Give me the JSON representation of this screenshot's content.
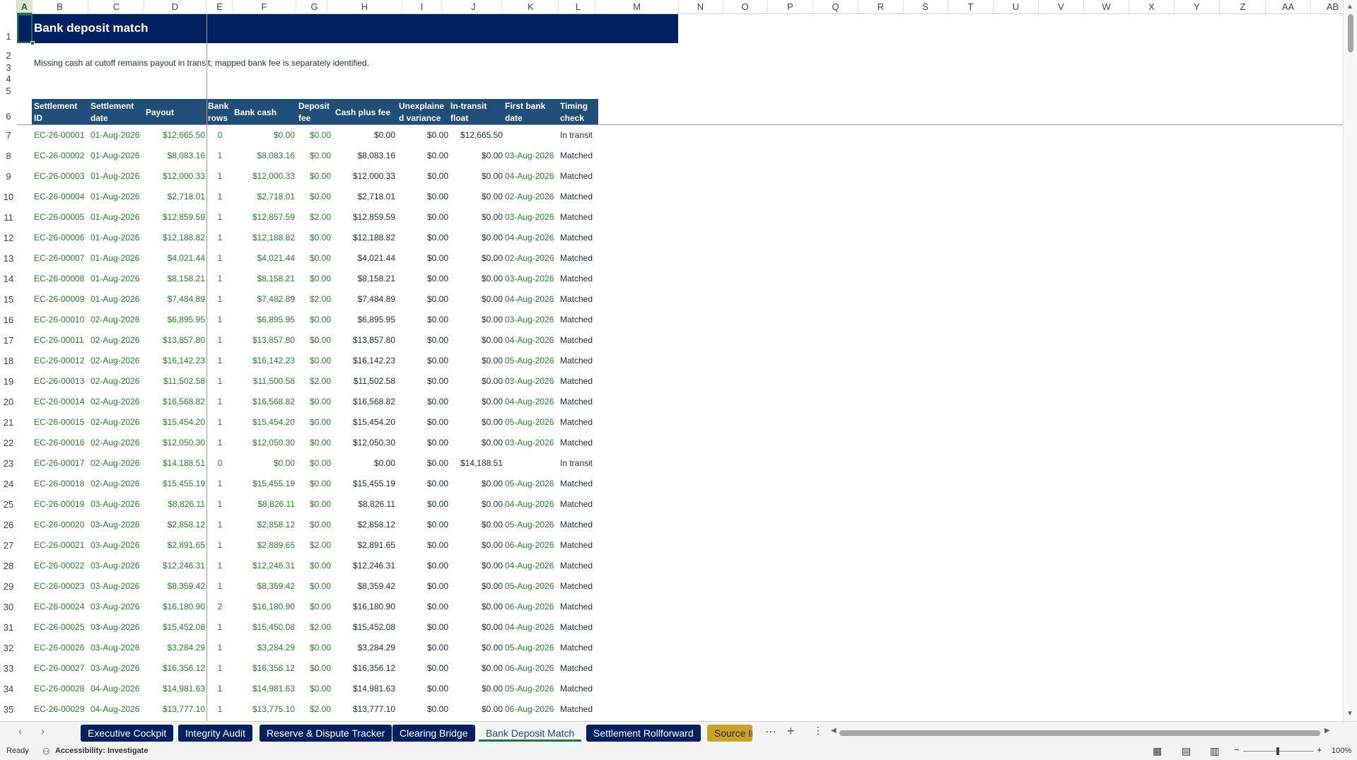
{
  "columns": [
    "A",
    "B",
    "C",
    "D",
    "E",
    "F",
    "G",
    "H",
    "I",
    "J",
    "K",
    "L",
    "M",
    "N",
    "O",
    "P",
    "Q",
    "R",
    "S",
    "T",
    "U",
    "V",
    "W",
    "X",
    "Y",
    "Z",
    "AA",
    "AB"
  ],
  "row_numbers": [
    "1",
    "2",
    "3",
    "4",
    "5",
    "6",
    "7",
    "8",
    "9",
    "10",
    "11",
    "12",
    "13",
    "14",
    "15",
    "16",
    "17",
    "18",
    "19",
    "20",
    "21",
    "22",
    "23",
    "24",
    "25",
    "26",
    "27",
    "28",
    "29",
    "30",
    "31",
    "32",
    "33",
    "34",
    "35"
  ],
  "sheet": {
    "title": "Bank deposit match",
    "subtitle": "Missing cash at cutoff remains payout in transit; mapped bank fee is separately identified.",
    "headers": [
      {
        "l1": "Settlement",
        "l2": "ID"
      },
      {
        "l1": "Settlement",
        "l2": "date"
      },
      {
        "l1": "Payout",
        "l2": ""
      },
      {
        "l1": "Bank",
        "l2": "rows"
      },
      {
        "l1": "Bank cash",
        "l2": ""
      },
      {
        "l1": "Deposit",
        "l2": "fee"
      },
      {
        "l1": "Cash plus fee",
        "l2": ""
      },
      {
        "l1": "Unexplaine",
        "l2": "d variance"
      },
      {
        "l1": "In-transit",
        "l2": "float"
      },
      {
        "l1": "First bank",
        "l2": "date"
      },
      {
        "l1": "Timing",
        "l2": "check"
      }
    ],
    "rows": [
      [
        "EC-26-00001",
        "01-Aug-2026",
        "$12,665.50",
        "0",
        "$0.00",
        "$0.00",
        "$0.00",
        "$0.00",
        "$12,665.50",
        "",
        "In transit"
      ],
      [
        "EC-26-00002",
        "01-Aug-2026",
        "$8,083.16",
        "1",
        "$8,083.16",
        "$0.00",
        "$8,083.16",
        "$0.00",
        "$0.00",
        "03-Aug-2026",
        "Matched"
      ],
      [
        "EC-26-00003",
        "01-Aug-2026",
        "$12,000.33",
        "1",
        "$12,000.33",
        "$0.00",
        "$12,000.33",
        "$0.00",
        "$0.00",
        "04-Aug-2026",
        "Matched"
      ],
      [
        "EC-26-00004",
        "01-Aug-2026",
        "$2,718.01",
        "1",
        "$2,718.01",
        "$0.00",
        "$2,718.01",
        "$0.00",
        "$0.00",
        "02-Aug-2026",
        "Matched"
      ],
      [
        "EC-26-00005",
        "01-Aug-2026",
        "$12,859.59",
        "1",
        "$12,857.59",
        "$2.00",
        "$12,859.59",
        "$0.00",
        "$0.00",
        "03-Aug-2026",
        "Matched"
      ],
      [
        "EC-26-00006",
        "01-Aug-2026",
        "$12,188.82",
        "1",
        "$12,188.82",
        "$0.00",
        "$12,188.82",
        "$0.00",
        "$0.00",
        "04-Aug-2026",
        "Matched"
      ],
      [
        "EC-26-00007",
        "01-Aug-2026",
        "$4,021.44",
        "1",
        "$4,021.44",
        "$0.00",
        "$4,021.44",
        "$0.00",
        "$0.00",
        "02-Aug-2026",
        "Matched"
      ],
      [
        "EC-26-00008",
        "01-Aug-2026",
        "$8,158.21",
        "1",
        "$8,158.21",
        "$0.00",
        "$8,158.21",
        "$0.00",
        "$0.00",
        "03-Aug-2026",
        "Matched"
      ],
      [
        "EC-26-00009",
        "01-Aug-2026",
        "$7,484.89",
        "1",
        "$7,482.89",
        "$2.00",
        "$7,484.89",
        "$0.00",
        "$0.00",
        "04-Aug-2026",
        "Matched"
      ],
      [
        "EC-26-00010",
        "02-Aug-2026",
        "$6,895.95",
        "1",
        "$6,895.95",
        "$0.00",
        "$6,895.95",
        "$0.00",
        "$0.00",
        "03-Aug-2026",
        "Matched"
      ],
      [
        "EC-26-00011",
        "02-Aug-2026",
        "$13,857.80",
        "1",
        "$13,857.80",
        "$0.00",
        "$13,857.80",
        "$0.00",
        "$0.00",
        "04-Aug-2026",
        "Matched"
      ],
      [
        "EC-26-00012",
        "02-Aug-2026",
        "$16,142.23",
        "1",
        "$16,142.23",
        "$0.00",
        "$16,142.23",
        "$0.00",
        "$0.00",
        "05-Aug-2026",
        "Matched"
      ],
      [
        "EC-26-00013",
        "02-Aug-2026",
        "$11,502.58",
        "1",
        "$11,500.58",
        "$2.00",
        "$11,502.58",
        "$0.00",
        "$0.00",
        "03-Aug-2026",
        "Matched"
      ],
      [
        "EC-26-00014",
        "02-Aug-2026",
        "$16,568.82",
        "1",
        "$16,568.82",
        "$0.00",
        "$16,568.82",
        "$0.00",
        "$0.00",
        "04-Aug-2026",
        "Matched"
      ],
      [
        "EC-26-00015",
        "02-Aug-2026",
        "$15,454.20",
        "1",
        "$15,454.20",
        "$0.00",
        "$15,454.20",
        "$0.00",
        "$0.00",
        "05-Aug-2026",
        "Matched"
      ],
      [
        "EC-26-00016",
        "02-Aug-2026",
        "$12,050.30",
        "1",
        "$12,050.30",
        "$0.00",
        "$12,050.30",
        "$0.00",
        "$0.00",
        "03-Aug-2026",
        "Matched"
      ],
      [
        "EC-26-00017",
        "02-Aug-2026",
        "$14,188.51",
        "0",
        "$0.00",
        "$0.00",
        "$0.00",
        "$0.00",
        "$14,188.51",
        "",
        "In transit"
      ],
      [
        "EC-26-00018",
        "02-Aug-2026",
        "$15,455.19",
        "1",
        "$15,455.19",
        "$0.00",
        "$15,455.19",
        "$0.00",
        "$0.00",
        "05-Aug-2026",
        "Matched"
      ],
      [
        "EC-26-00019",
        "03-Aug-2026",
        "$8,826.11",
        "1",
        "$8,826.11",
        "$0.00",
        "$8,826.11",
        "$0.00",
        "$0.00",
        "04-Aug-2026",
        "Matched"
      ],
      [
        "EC-26-00020",
        "03-Aug-2026",
        "$2,858.12",
        "1",
        "$2,858.12",
        "$0.00",
        "$2,858.12",
        "$0.00",
        "$0.00",
        "05-Aug-2026",
        "Matched"
      ],
      [
        "EC-26-00021",
        "03-Aug-2026",
        "$2,891.65",
        "1",
        "$2,889.65",
        "$2.00",
        "$2,891.65",
        "$0.00",
        "$0.00",
        "06-Aug-2026",
        "Matched"
      ],
      [
        "EC-26-00022",
        "03-Aug-2026",
        "$12,246.31",
        "1",
        "$12,246.31",
        "$0.00",
        "$12,246.31",
        "$0.00",
        "$0.00",
        "04-Aug-2026",
        "Matched"
      ],
      [
        "EC-26-00023",
        "03-Aug-2026",
        "$8,359.42",
        "1",
        "$8,359.42",
        "$0.00",
        "$8,359.42",
        "$0.00",
        "$0.00",
        "05-Aug-2026",
        "Matched"
      ],
      [
        "EC-26-00024",
        "03-Aug-2026",
        "$16,180.90",
        "2",
        "$16,180.90",
        "$0.00",
        "$16,180.90",
        "$0.00",
        "$0.00",
        "06-Aug-2026",
        "Matched"
      ],
      [
        "EC-26-00025",
        "03-Aug-2026",
        "$15,452.08",
        "1",
        "$15,450.08",
        "$2.00",
        "$15,452.08",
        "$0.00",
        "$0.00",
        "04-Aug-2026",
        "Matched"
      ],
      [
        "EC-26-00026",
        "03-Aug-2026",
        "$3,284.29",
        "1",
        "$3,284.29",
        "$0.00",
        "$3,284.29",
        "$0.00",
        "$0.00",
        "05-Aug-2026",
        "Matched"
      ],
      [
        "EC-26-00027",
        "03-Aug-2026",
        "$16,356.12",
        "1",
        "$16,356.12",
        "$0.00",
        "$16,356.12",
        "$0.00",
        "$0.00",
        "06-Aug-2026",
        "Matched"
      ],
      [
        "EC-26-00028",
        "04-Aug-2026",
        "$14,981.63",
        "1",
        "$14,981.63",
        "$0.00",
        "$14,981.63",
        "$0.00",
        "$0.00",
        "05-Aug-2026",
        "Matched"
      ],
      [
        "EC-26-00029",
        "04-Aug-2026",
        "$13,777.10",
        "1",
        "$13,775.10",
        "$2.00",
        "$13,777.10",
        "$0.00",
        "$0.00",
        "06-Aug-2026",
        "Matched"
      ]
    ]
  },
  "tabs": {
    "items": [
      "Executive Cockpit",
      "Integrity Audit",
      "Reserve & Dispute Tracker",
      "Clearing Bridge",
      "Bank Deposit Match",
      "Settlement Rollforward",
      "Source In"
    ],
    "active": "Bank Deposit Match",
    "more_icon": "ellipsis-icon",
    "add_icon": "plus-icon",
    "menu_icon": "vertical-dots-icon"
  },
  "status": {
    "ready": "Ready",
    "accessibility": "Accessibility: Investigate",
    "zoom": "100%"
  },
  "colors": {
    "title_band": "#002060",
    "header_band": "#1f4e79",
    "value_green": "#2e7d32",
    "tab_navy": "#002060",
    "tab_gold": "#c9a227",
    "selection": "#217346"
  }
}
